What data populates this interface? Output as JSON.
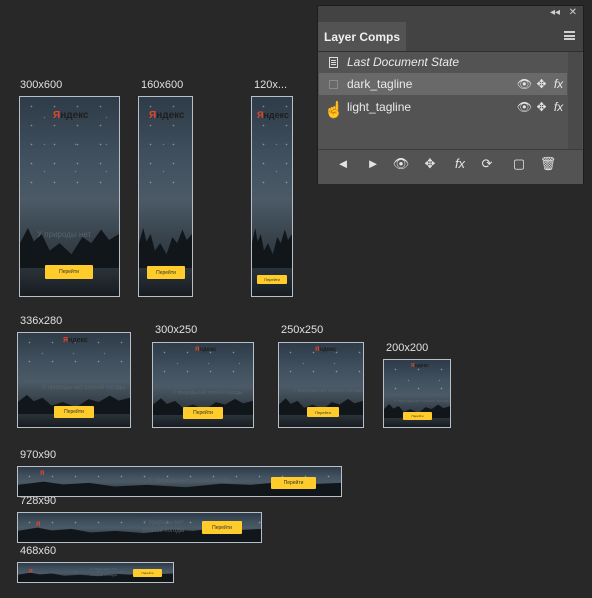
{
  "sizes": {
    "s300x600": "300x600",
    "s160x600": "160x600",
    "s120x": "120x...",
    "s336x280": "336x280",
    "s300x250": "300x250",
    "s250x250": "250x250",
    "s200x200": "200x200",
    "s970x90": "970x90",
    "s728x90": "728x90",
    "s468x60": "468x60"
  },
  "banner": {
    "logo_first": "Я",
    "logo_rest": "ндекс",
    "tagline": "У природы нет плохой погоды",
    "tagline_short": "У природы нет",
    "tagline_line1": "У природы нет",
    "tagline_line2": "плохой погоды",
    "cta": "Перейти"
  },
  "panel": {
    "title": "Layer Comps",
    "collapse_glyph": "◂◂",
    "close_glyph": "✕",
    "rows": [
      {
        "label": "Last Document State"
      },
      {
        "label": "dark_tagline"
      },
      {
        "label": "light_tagline"
      }
    ],
    "row_icons": {
      "visibility": "👁",
      "position": "✥",
      "fx": "fx"
    },
    "buttons": {
      "prev": "◄",
      "next": "►",
      "update_visibility": "👁",
      "update_position": "✥",
      "update_style": "fx",
      "update_all": "⟳",
      "new_comp": "▢",
      "delete": "🗑"
    }
  },
  "colors": {
    "cta_yellow": "#ffcc2b",
    "panel_bg": "#535353",
    "selected_row": "#696969",
    "canvas_bg": "#282828"
  }
}
